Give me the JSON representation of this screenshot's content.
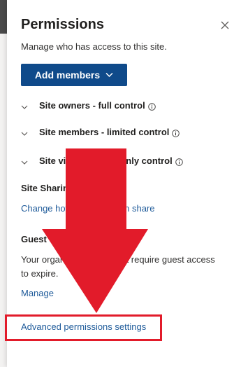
{
  "panel": {
    "title": "Permissions",
    "subtitle": "Manage who has access to this site.",
    "add_members_label": "Add members"
  },
  "groups": [
    {
      "label": "Site owners - full control"
    },
    {
      "label": "Site members - limited control"
    },
    {
      "label": "Site visitors - read only control"
    }
  ],
  "sharing": {
    "title": "Site Sharing",
    "link": "Change how members can share"
  },
  "guest": {
    "title": "Guest expiration",
    "text": "Your organization does not require guest access to expire.",
    "manage_link": "Manage"
  },
  "advanced_link": "Advanced permissions settings",
  "colors": {
    "primary_button": "#0f4a8a",
    "link": "#1f5b9a",
    "annotation_red": "#e21b2a"
  },
  "icons": {
    "close": "close-icon",
    "chevron": "chevron-down-icon",
    "info": "info-icon"
  }
}
